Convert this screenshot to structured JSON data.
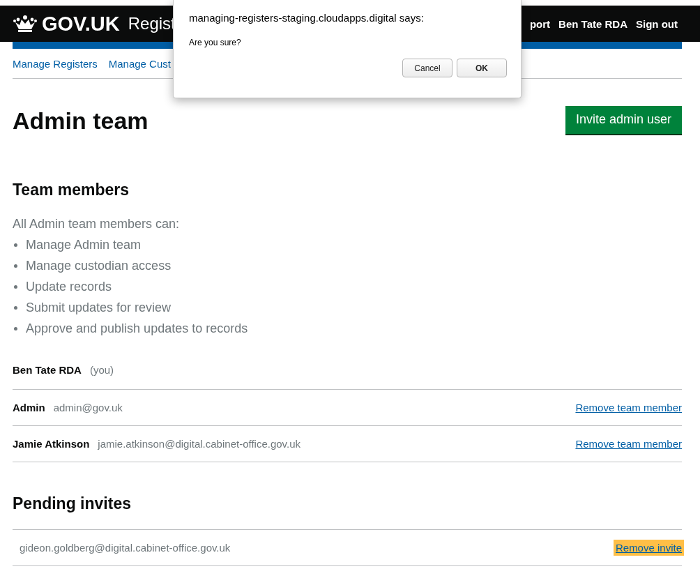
{
  "header": {
    "logo": "GOV.UK",
    "service": "Regist",
    "nav": [
      "port",
      "Ben Tate RDA",
      "Sign out"
    ]
  },
  "subnav": [
    "Manage Registers",
    "Manage Cust"
  ],
  "dialog": {
    "title": "managing-registers-staging.cloudapps.digital says:",
    "message": "Are you sure?",
    "buttons": [
      {
        "label": "Cancel",
        "default": false
      },
      {
        "label": "OK",
        "default": true
      }
    ]
  },
  "page": {
    "title": "Admin team",
    "action": "Invite admin user"
  },
  "team": {
    "heading": "Team members",
    "intro": "All Admin team members can:",
    "permissions": [
      "Manage Admin team",
      "Manage custodian access",
      "Update records",
      "Submit updates for review",
      "Approve and publish updates to records"
    ],
    "members": [
      {
        "name": "Ben Tate RDA",
        "detail": "(you)"
      },
      {
        "name": "Admin",
        "detail": "admin@gov.uk",
        "action": "Remove team member"
      },
      {
        "name": "Jamie Atkinson",
        "detail": "jamie.atkinson@digital.cabinet-office.gov.uk",
        "action": "Remove team member"
      }
    ]
  },
  "pending": {
    "heading": "Pending invites",
    "invites": [
      {
        "email": "gideon.goldberg@digital.cabinet-office.gov.uk",
        "action": "Remove invite",
        "focused": true
      }
    ]
  }
}
